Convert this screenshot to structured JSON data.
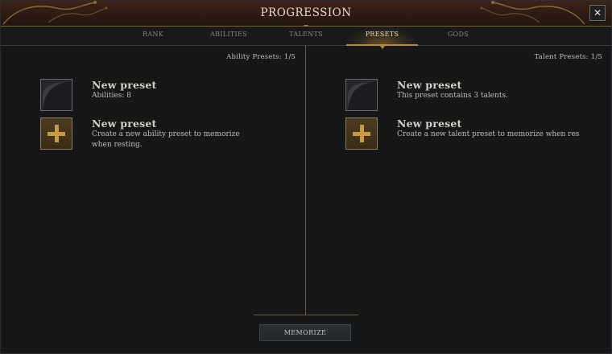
{
  "window": {
    "title": "PROGRESSION",
    "close_symbol": "✕"
  },
  "tabs": [
    {
      "label": "RANK",
      "active": false
    },
    {
      "label": "ABILITIES",
      "active": false
    },
    {
      "label": "TALENTS",
      "active": false
    },
    {
      "label": "PRESETS",
      "active": true
    },
    {
      "label": "GODS",
      "active": false
    }
  ],
  "left_panel": {
    "header": "Ability Presets: 1/5",
    "presets": [
      {
        "name": "New preset",
        "description": "Abilities: 8",
        "icon": "preset-thumbnail-icon"
      },
      {
        "name": "New preset",
        "description": "Create a new ability preset to memorize when resting.",
        "icon": "plus-icon"
      }
    ]
  },
  "right_panel": {
    "header": "Talent Presets: 1/5",
    "presets": [
      {
        "name": "New preset",
        "description": "This preset contains 3 talents.",
        "icon": "preset-thumbnail-icon"
      },
      {
        "name": "New preset",
        "description": "Create a new talent preset to memorize when resting",
        "icon": "plus-icon"
      }
    ]
  },
  "footer": {
    "memorize_label": "MEMORIZE"
  },
  "colors": {
    "accent_gold": "#b48a3c",
    "title_bar": "#2e1b13",
    "background": "#151719"
  }
}
